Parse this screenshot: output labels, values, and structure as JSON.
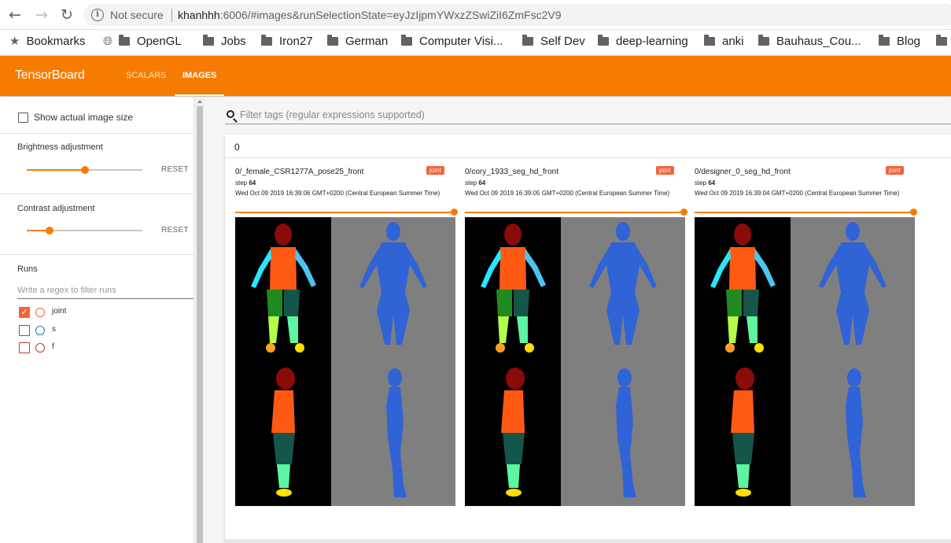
{
  "browser": {
    "url_security": "Not secure",
    "url_host": "khanhhh",
    "url_rest": ":6006/#images&runSelectionState=eyJzIjpmYWxzZSwiZiI6ZmFsc2V9",
    "bookmarks": [
      "Bookmarks",
      "OpenGL",
      "Jobs",
      "Iron27",
      "German",
      "Computer Visi...",
      "Self Dev",
      "deep-learning",
      "anki",
      "Bauhaus_Cou...",
      "Blog"
    ]
  },
  "header": {
    "title": "TensorBoard",
    "tabs": [
      "SCALARS",
      "IMAGES"
    ],
    "active_tab": "IMAGES",
    "accent": "#f57c00"
  },
  "sidebar": {
    "show_actual_size": "Show actual image size",
    "brightness": {
      "label": "Brightness adjustment",
      "reset": "RESET",
      "value": 0.5
    },
    "contrast": {
      "label": "Contrast adjustment",
      "reset": "RESET",
      "value": 0.2
    },
    "runs": {
      "title": "Runs",
      "placeholder": "Write a regex to filter runs",
      "items": [
        {
          "name": "joint",
          "checked": true,
          "color": "#f4623a"
        },
        {
          "name": "s",
          "checked": false,
          "color": "#1f77b4"
        },
        {
          "name": "f",
          "checked": false,
          "color": "#c0392b"
        }
      ]
    }
  },
  "main": {
    "filter_placeholder": "Filter tags (regular expressions supported)",
    "group_title": "0",
    "cards": [
      {
        "tag": "0/_female_CSR1277A_pose25_front",
        "run": "joint",
        "step_label": "step",
        "step": "64",
        "time": "Wed Oct 09 2019 16:39:06 GMT+0200 (Central European Summer Time)"
      },
      {
        "tag": "0/cory_1933_seg_hd_front",
        "run": "joint",
        "step_label": "step",
        "step": "64",
        "time": "Wed Oct 09 2019 16:39:05 GMT+0200 (Central European Summer Time)"
      },
      {
        "tag": "0/designer_0_seg_hd_front",
        "run": "joint",
        "step_label": "step",
        "step": "64",
        "time": "Wed Oct 09 2019 16:39:04 GMT+0200 (Central European Summer Time)"
      }
    ]
  }
}
